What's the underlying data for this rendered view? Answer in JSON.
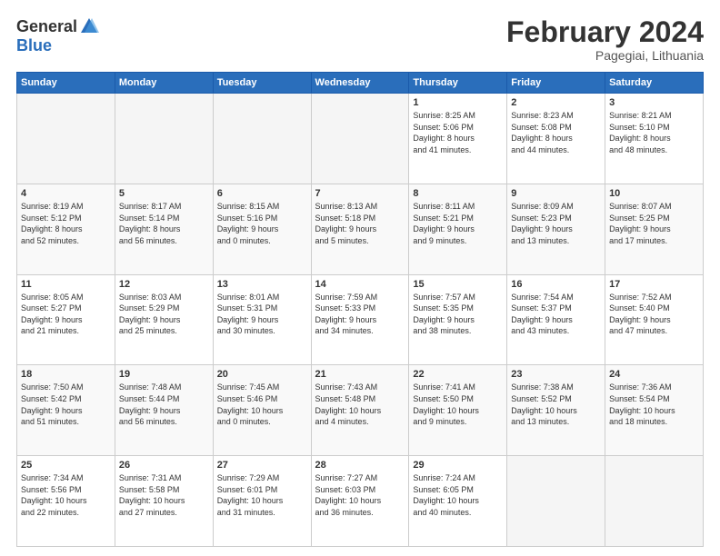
{
  "header": {
    "logo_general": "General",
    "logo_blue": "Blue",
    "month_title": "February 2024",
    "location": "Pagegiai, Lithuania"
  },
  "weekdays": [
    "Sunday",
    "Monday",
    "Tuesday",
    "Wednesday",
    "Thursday",
    "Friday",
    "Saturday"
  ],
  "weeks": [
    [
      {
        "day": "",
        "info": ""
      },
      {
        "day": "",
        "info": ""
      },
      {
        "day": "",
        "info": ""
      },
      {
        "day": "",
        "info": ""
      },
      {
        "day": "1",
        "info": "Sunrise: 8:25 AM\nSunset: 5:06 PM\nDaylight: 8 hours\nand 41 minutes."
      },
      {
        "day": "2",
        "info": "Sunrise: 8:23 AM\nSunset: 5:08 PM\nDaylight: 8 hours\nand 44 minutes."
      },
      {
        "day": "3",
        "info": "Sunrise: 8:21 AM\nSunset: 5:10 PM\nDaylight: 8 hours\nand 48 minutes."
      }
    ],
    [
      {
        "day": "4",
        "info": "Sunrise: 8:19 AM\nSunset: 5:12 PM\nDaylight: 8 hours\nand 52 minutes."
      },
      {
        "day": "5",
        "info": "Sunrise: 8:17 AM\nSunset: 5:14 PM\nDaylight: 8 hours\nand 56 minutes."
      },
      {
        "day": "6",
        "info": "Sunrise: 8:15 AM\nSunset: 5:16 PM\nDaylight: 9 hours\nand 0 minutes."
      },
      {
        "day": "7",
        "info": "Sunrise: 8:13 AM\nSunset: 5:18 PM\nDaylight: 9 hours\nand 5 minutes."
      },
      {
        "day": "8",
        "info": "Sunrise: 8:11 AM\nSunset: 5:21 PM\nDaylight: 9 hours\nand 9 minutes."
      },
      {
        "day": "9",
        "info": "Sunrise: 8:09 AM\nSunset: 5:23 PM\nDaylight: 9 hours\nand 13 minutes."
      },
      {
        "day": "10",
        "info": "Sunrise: 8:07 AM\nSunset: 5:25 PM\nDaylight: 9 hours\nand 17 minutes."
      }
    ],
    [
      {
        "day": "11",
        "info": "Sunrise: 8:05 AM\nSunset: 5:27 PM\nDaylight: 9 hours\nand 21 minutes."
      },
      {
        "day": "12",
        "info": "Sunrise: 8:03 AM\nSunset: 5:29 PM\nDaylight: 9 hours\nand 25 minutes."
      },
      {
        "day": "13",
        "info": "Sunrise: 8:01 AM\nSunset: 5:31 PM\nDaylight: 9 hours\nand 30 minutes."
      },
      {
        "day": "14",
        "info": "Sunrise: 7:59 AM\nSunset: 5:33 PM\nDaylight: 9 hours\nand 34 minutes."
      },
      {
        "day": "15",
        "info": "Sunrise: 7:57 AM\nSunset: 5:35 PM\nDaylight: 9 hours\nand 38 minutes."
      },
      {
        "day": "16",
        "info": "Sunrise: 7:54 AM\nSunset: 5:37 PM\nDaylight: 9 hours\nand 43 minutes."
      },
      {
        "day": "17",
        "info": "Sunrise: 7:52 AM\nSunset: 5:40 PM\nDaylight: 9 hours\nand 47 minutes."
      }
    ],
    [
      {
        "day": "18",
        "info": "Sunrise: 7:50 AM\nSunset: 5:42 PM\nDaylight: 9 hours\nand 51 minutes."
      },
      {
        "day": "19",
        "info": "Sunrise: 7:48 AM\nSunset: 5:44 PM\nDaylight: 9 hours\nand 56 minutes."
      },
      {
        "day": "20",
        "info": "Sunrise: 7:45 AM\nSunset: 5:46 PM\nDaylight: 10 hours\nand 0 minutes."
      },
      {
        "day": "21",
        "info": "Sunrise: 7:43 AM\nSunset: 5:48 PM\nDaylight: 10 hours\nand 4 minutes."
      },
      {
        "day": "22",
        "info": "Sunrise: 7:41 AM\nSunset: 5:50 PM\nDaylight: 10 hours\nand 9 minutes."
      },
      {
        "day": "23",
        "info": "Sunrise: 7:38 AM\nSunset: 5:52 PM\nDaylight: 10 hours\nand 13 minutes."
      },
      {
        "day": "24",
        "info": "Sunrise: 7:36 AM\nSunset: 5:54 PM\nDaylight: 10 hours\nand 18 minutes."
      }
    ],
    [
      {
        "day": "25",
        "info": "Sunrise: 7:34 AM\nSunset: 5:56 PM\nDaylight: 10 hours\nand 22 minutes."
      },
      {
        "day": "26",
        "info": "Sunrise: 7:31 AM\nSunset: 5:58 PM\nDaylight: 10 hours\nand 27 minutes."
      },
      {
        "day": "27",
        "info": "Sunrise: 7:29 AM\nSunset: 6:01 PM\nDaylight: 10 hours\nand 31 minutes."
      },
      {
        "day": "28",
        "info": "Sunrise: 7:27 AM\nSunset: 6:03 PM\nDaylight: 10 hours\nand 36 minutes."
      },
      {
        "day": "29",
        "info": "Sunrise: 7:24 AM\nSunset: 6:05 PM\nDaylight: 10 hours\nand 40 minutes."
      },
      {
        "day": "",
        "info": ""
      },
      {
        "day": "",
        "info": ""
      }
    ]
  ]
}
